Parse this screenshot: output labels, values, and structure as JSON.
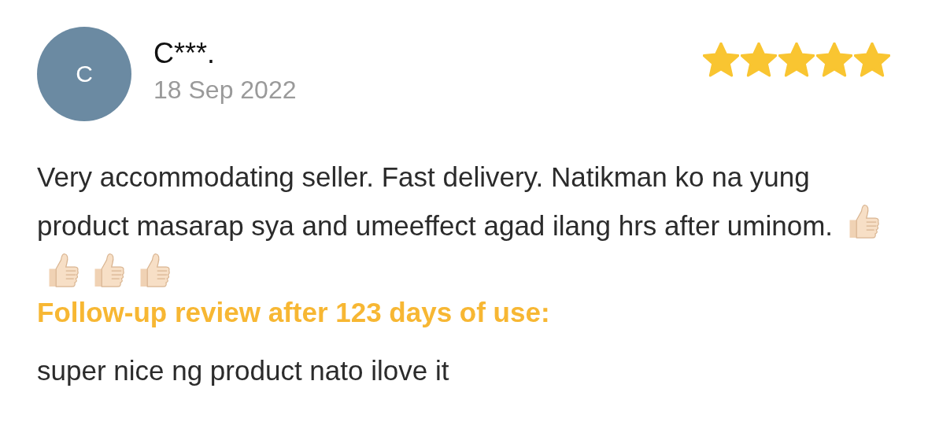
{
  "review": {
    "avatar_initial": "C",
    "reviewer": "C***.",
    "date": "18 Sep 2022",
    "stars": 5,
    "text": "Very accommodating seller. Fast delivery. Natikman ko na yung product masarap sya and umeeffect agad ilang hrs after uminom.",
    "reactions": [
      {
        "kind": "thumbs-up"
      },
      {
        "kind": "thumbs-up"
      },
      {
        "kind": "thumbs-up"
      },
      {
        "kind": "thumbs-up"
      }
    ],
    "follow_up_label": "Follow-up review after 123 days of use:",
    "follow_up_text": "super nice ng product nato ilove it"
  }
}
